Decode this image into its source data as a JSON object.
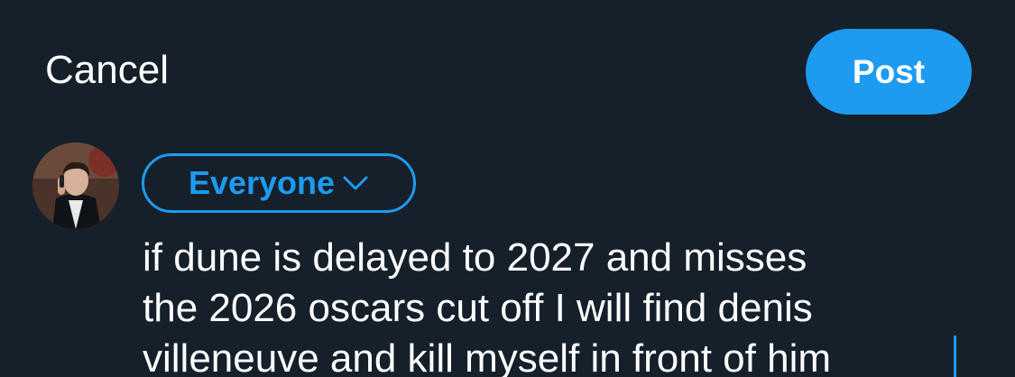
{
  "header": {
    "cancel_label": "Cancel",
    "post_label": "Post"
  },
  "composer": {
    "audience_label": "Everyone",
    "text": "if dune is delayed to 2027 and misses\nthe 2026 oscars cut off I will find denis\nvilleneuve and kill myself in front of him"
  },
  "colors": {
    "background": "#15202b",
    "accent": "#1d9bf0",
    "text": "#ffffff"
  },
  "icons": {
    "audience_chevron": "chevron-down-icon",
    "avatar": "avatar"
  }
}
